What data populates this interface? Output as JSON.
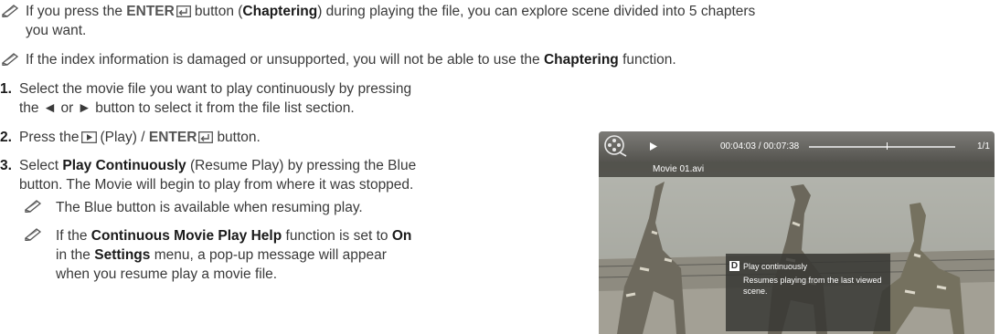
{
  "note1": {
    "part1": "If you press the",
    "enter_label": "ENTER",
    "part2": "button (",
    "chaptering": "Chaptering",
    "part3": ") during playing the file, you can explore scene divided into 5 chapters",
    "line2": "you want."
  },
  "note2": {
    "part1": "If the index information is damaged or unsupported, you will not be able to use the",
    "chaptering": "Chaptering",
    "part2": "function."
  },
  "steps": [
    {
      "num": "1.",
      "line1": "Select the movie file you want to play continuously by pressing",
      "line2": "the ◄ or ► button to select it from the file list section."
    },
    {
      "num": "2.",
      "part1": "Press the",
      "play_label": "(Play) /",
      "enter_label": "ENTER",
      "part2": "button."
    },
    {
      "num": "3.",
      "part1": "Select",
      "bold1": "Play Continuously",
      "part2": "(Resume Play) by pressing the Blue",
      "line2": "button. The Movie will begin to play from where it was stopped."
    }
  ],
  "subnotes": [
    {
      "text": "The Blue button is available when resuming play."
    },
    {
      "part1": "If the",
      "bold1": "Continuous Movie Play Help",
      "part2": "function is set to",
      "bold2": "On",
      "part3": "in the",
      "bold3": "Settings",
      "part4": "menu, a pop-up message will appear",
      "line3": "when you resume play a movie file."
    }
  ],
  "screenshot": {
    "time": "00:04:03 / 00:07:38",
    "progress": 0.53,
    "page": "1/1",
    "filename": "Movie 01.avi",
    "popup_key": "D",
    "popup_title": "Play continuously",
    "popup_line1": "Resumes playing from the last viewed",
    "popup_line2": "scene."
  }
}
